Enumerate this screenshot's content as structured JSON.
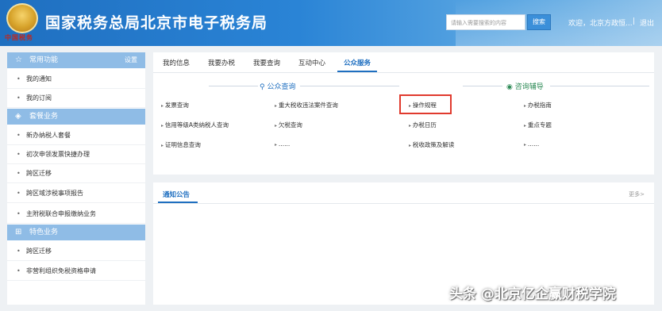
{
  "header": {
    "emblem_text": "中国税务",
    "site_title": "国家税务总局北京市电子税务局",
    "search_placeholder": "请输入需要搜索的内容",
    "search_button": "搜索",
    "user_info": "欢迎，北京方政恒...",
    "separator": "|",
    "logout": "退出"
  },
  "sidebar": {
    "sections": [
      {
        "title": "常用功能",
        "right": "设置",
        "icon": "star-icon",
        "items": [
          "我的通知",
          "我的订阅"
        ]
      },
      {
        "title": "套餐业务",
        "icon": "layers-icon",
        "items": [
          "新办纳税人套餐",
          "初次申领发票快捷办理",
          "跨区迁移",
          "跨区域涉税事项报告",
          "主附税联合申报缴纳业务"
        ]
      },
      {
        "title": "特色业务",
        "icon": "grid-icon",
        "items": [
          "跨区迁移",
          "非营利组织免税资格申请"
        ]
      }
    ]
  },
  "tabs": [
    "我的信息",
    "我要办税",
    "我要查询",
    "互动中心",
    "公众服务"
  ],
  "active_tab": "公众服务",
  "public_query": {
    "title": "公众查询",
    "icon": "search-icon",
    "links": [
      "发票查询",
      "重大税收违法案件查询",
      "信用等级A类纳税人查询",
      "欠税查询",
      "证明信息查询",
      "......"
    ]
  },
  "consult": {
    "title": "咨询辅导",
    "icon": "chat-icon",
    "links": [
      "操作规程",
      "办税指南",
      "办税日历",
      "重点专题",
      "税收政策及解读",
      "......"
    ]
  },
  "notice": {
    "title": "通知公告",
    "more": "更多>"
  },
  "watermark": "头条 @北京亿企赢财税学院"
}
